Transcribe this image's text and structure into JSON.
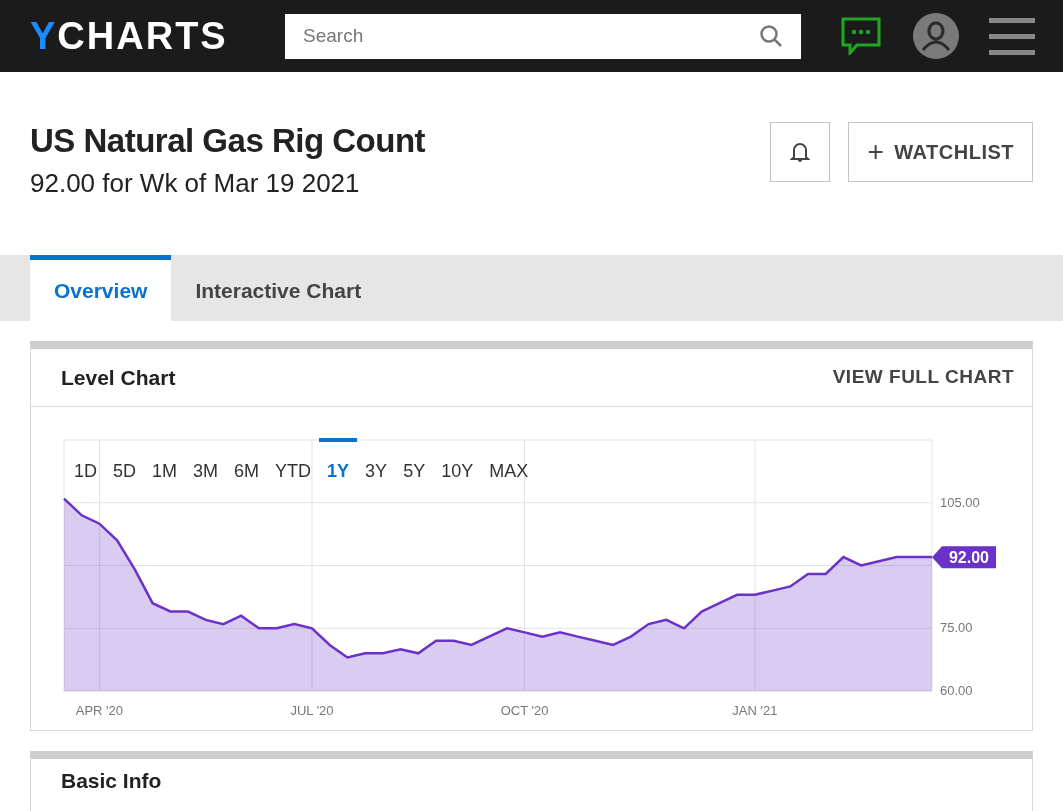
{
  "header": {
    "logo": "YCHARTS",
    "search": {
      "placeholder": "Search"
    }
  },
  "title": "US Natural Gas Rig Count",
  "subtitle": "92.00 for Wk of Mar 19 2021",
  "watchlist_button": {
    "icon": "+",
    "label": "WATCHLIST"
  },
  "tabs": [
    {
      "label": "Overview",
      "selected": true
    },
    {
      "label": "Interactive Chart",
      "selected": false
    }
  ],
  "level_chart": {
    "title": "Level Chart",
    "link": "VIEW FULL CHART",
    "ranges": [
      {
        "label": "1D",
        "selected": false
      },
      {
        "label": "5D",
        "selected": false
      },
      {
        "label": "1M",
        "selected": false
      },
      {
        "label": "3M",
        "selected": false
      },
      {
        "label": "6M",
        "selected": false
      },
      {
        "label": "YTD",
        "selected": false
      },
      {
        "label": "1Y",
        "selected": true
      },
      {
        "label": "3Y",
        "selected": false
      },
      {
        "label": "5Y",
        "selected": false
      },
      {
        "label": "10Y",
        "selected": false
      },
      {
        "label": "MAX",
        "selected": false
      }
    ],
    "current_value": "92.00",
    "chart_data": {
      "type": "area",
      "categories": [
        null,
        null,
        "APR '20",
        null,
        null,
        null,
        null,
        null,
        null,
        null,
        null,
        null,
        null,
        null,
        "JUL '20",
        null,
        null,
        null,
        null,
        null,
        null,
        null,
        null,
        null,
        null,
        null,
        "OCT '20",
        null,
        null,
        null,
        null,
        null,
        null,
        null,
        null,
        null,
        null,
        null,
        null,
        "JAN '21",
        null,
        null,
        null,
        null,
        null,
        null,
        null,
        null,
        null,
        null
      ],
      "series": [
        {
          "color": "#6a32c9",
          "values": [
            106,
            102,
            100,
            96,
            89,
            81,
            79,
            79,
            77,
            76,
            78,
            75,
            75,
            76,
            75,
            71,
            68,
            69,
            69,
            70,
            69,
            72,
            72,
            71,
            73,
            75,
            74,
            73,
            74,
            73,
            72,
            71,
            73,
            76,
            77,
            75,
            79,
            81,
            83,
            83,
            84,
            85,
            88,
            88,
            92,
            90,
            91,
            92,
            92,
            92
          ]
        }
      ],
      "ylim": [
        60,
        120
      ],
      "grid": true,
      "yticks": [
        {
          "value": 105,
          "label": "105.00"
        },
        {
          "value": 75,
          "label": "75.00"
        },
        {
          "value": 60,
          "label": "60.00"
        }
      ]
    }
  },
  "basic_info": {
    "title": "Basic Info"
  }
}
